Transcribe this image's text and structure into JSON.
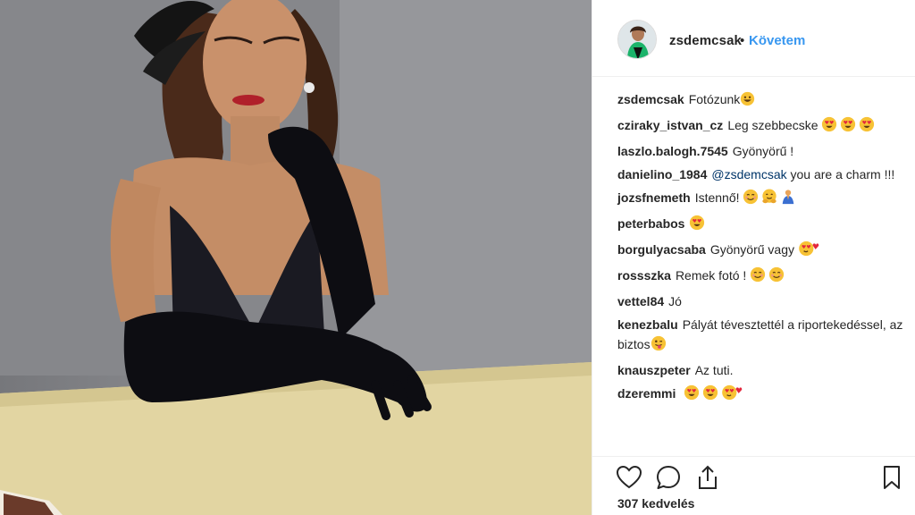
{
  "post": {
    "author": "zsdemcsak",
    "separator": "•",
    "follow_label": "Követem",
    "likes_text": "307 kedvelés"
  },
  "comments": [
    {
      "user": "zsdemcsak",
      "text": "Fotózunk",
      "emojis": [
        "grin"
      ]
    },
    {
      "user": "cziraky_istvan_cz",
      "text": "Leg szebbecske",
      "emojis": [
        "heart-eyes",
        "heart-eyes",
        "heart-eyes"
      ]
    },
    {
      "user": "laszlo.balogh.7545",
      "text": "Gyönyörű !",
      "emojis": []
    },
    {
      "user": "danielino_1984",
      "mention": "@zsdemcsak",
      "text": "you are a charm !!!",
      "emojis": []
    },
    {
      "user": "jozsfnemeth",
      "text": "Istennő!",
      "emojis": [
        "smile",
        "hug",
        "pray"
      ]
    },
    {
      "user": "peterbabos",
      "text": "",
      "emojis": [
        "heart-eyes"
      ]
    },
    {
      "user": "borgulyacsaba",
      "text": "Gyönyörű vagy",
      "emojis": [
        "kiss-heart"
      ]
    },
    {
      "user": "rossszka",
      "text": "Remek fotó !",
      "emojis": [
        "smile",
        "smile"
      ]
    },
    {
      "user": "vettel84",
      "text": "Jó",
      "emojis": []
    },
    {
      "user": "kenezbalu",
      "text": "Pályát tévesztettél a riportekedéssel, az biztos",
      "emojis": [
        "tongue"
      ]
    },
    {
      "user": "knauszpeter",
      "text": "Az tuti.",
      "emojis": []
    },
    {
      "user": "dzeremmi",
      "text": "",
      "emojis": [
        "heart-eyes",
        "heart-eyes",
        "kiss-heart"
      ]
    }
  ],
  "icons": {
    "like": "heart-outline-icon",
    "comment": "speech-bubble-icon",
    "share": "share-icon",
    "save": "bookmark-icon"
  }
}
